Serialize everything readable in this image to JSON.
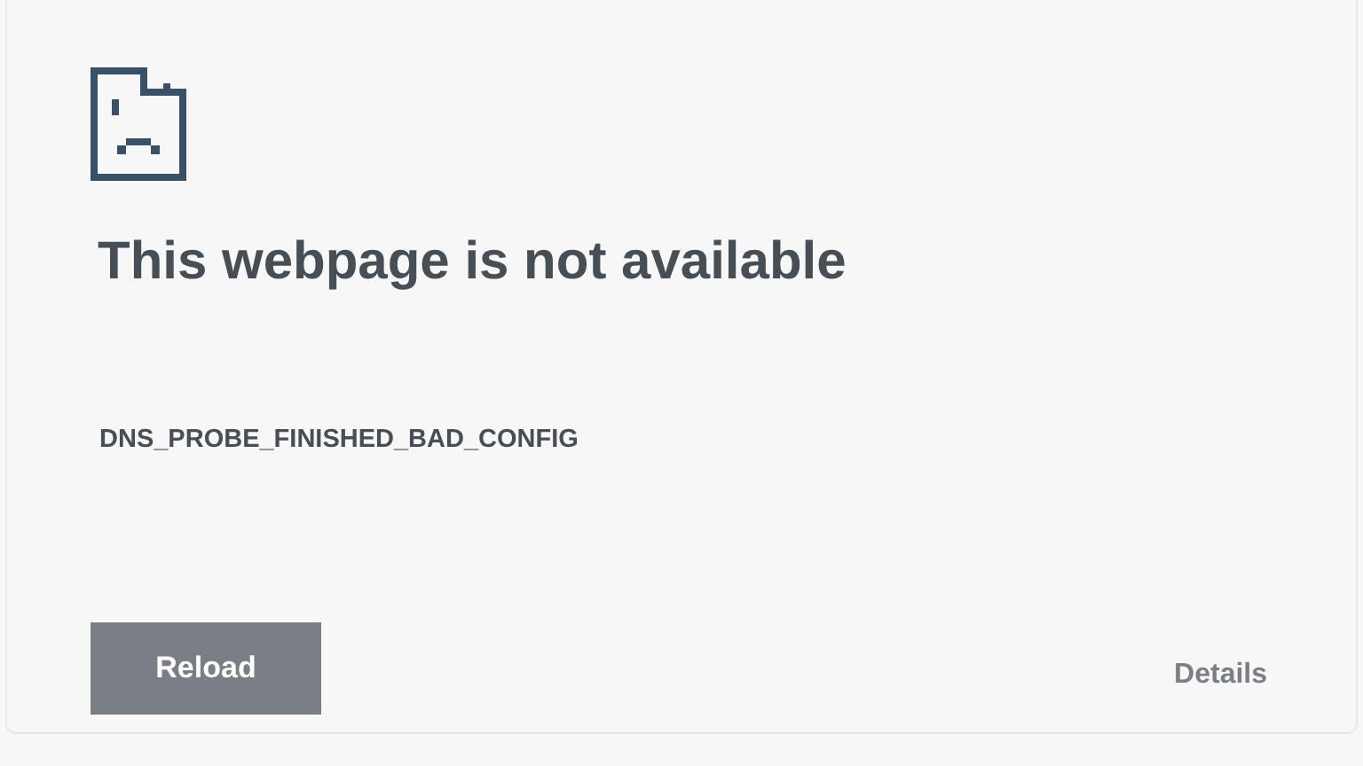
{
  "title": "This webpage is not available",
  "error_code": "DNS_PROBE_FINISHED_BAD_CONFIG",
  "buttons": {
    "reload": "Reload",
    "details": "Details"
  }
}
